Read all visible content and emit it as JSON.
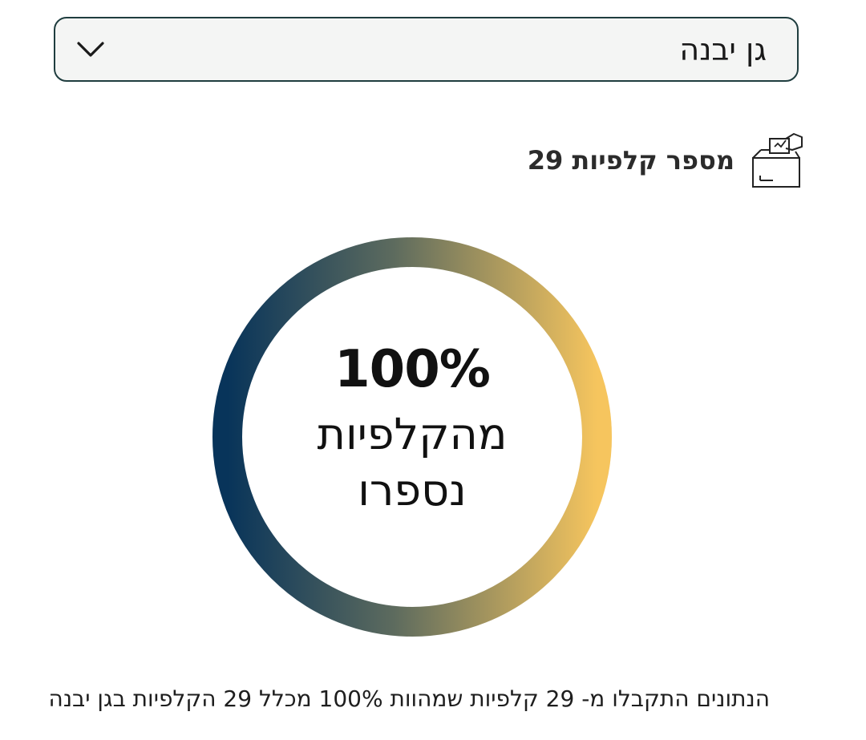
{
  "location_select": {
    "selected_value": "גן יבנה",
    "chevron_icon": "chevron-down-icon"
  },
  "stations": {
    "icon": "ballot-box-icon",
    "label": "מספר קלפיות 29"
  },
  "progress": {
    "percent_text": "100%",
    "caption": "מהקלפיות נספרו",
    "value": 100,
    "gradient_colors": [
      "#08345a",
      "#f6c55e"
    ]
  },
  "footer": {
    "text": "הנתונים התקבלו מ- 29 קלפיות שמהוות 100% מכלל 29 הקלפיות בגן יבנה"
  }
}
